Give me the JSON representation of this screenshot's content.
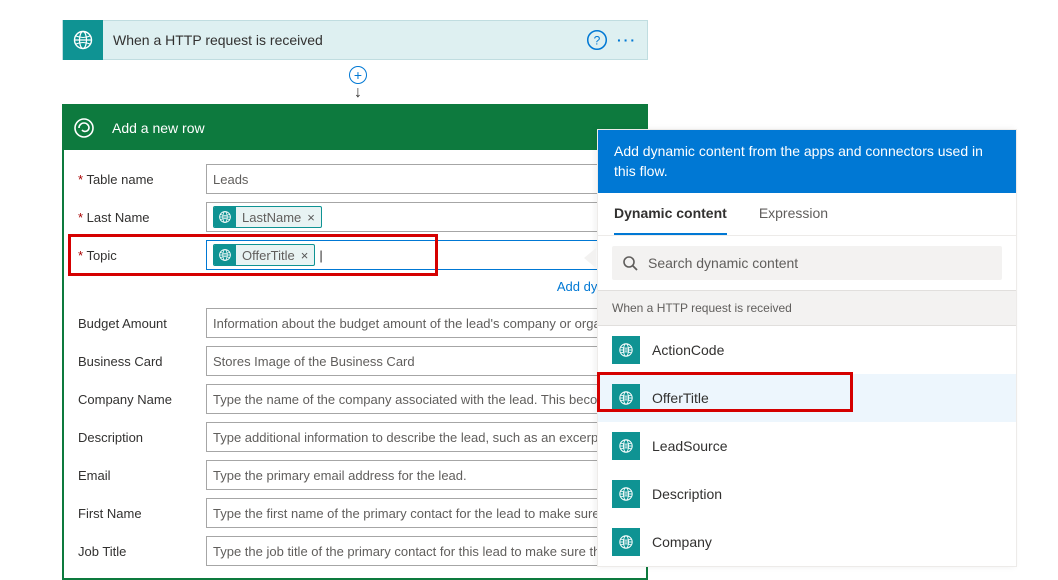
{
  "trigger": {
    "title": "When a HTTP request is received",
    "help_icon": "help-icon",
    "more_icon": "more-icon"
  },
  "connector": {
    "plus": "+",
    "arrow": "↓"
  },
  "action": {
    "title": "Add a new row",
    "fields": {
      "table_name": {
        "label": "Table name",
        "value": "Leads",
        "required": true
      },
      "last_name": {
        "label": "Last Name",
        "token": "LastName",
        "required": true
      },
      "topic": {
        "label": "Topic",
        "token": "OfferTitle",
        "required": true
      },
      "budget_amount": {
        "label": "Budget Amount",
        "placeholder": "Information about the budget amount of the lead's company or organ"
      },
      "business_card": {
        "label": "Business Card",
        "placeholder": "Stores Image of the Business Card"
      },
      "company_name": {
        "label": "Company Name",
        "placeholder": "Type the name of the company associated with the lead. This become"
      },
      "description": {
        "label": "Description",
        "placeholder": "Type additional information to describe the lead, such as an excerpt fr"
      },
      "email": {
        "label": "Email",
        "placeholder": "Type the primary email address for the lead."
      },
      "first_name": {
        "label": "First Name",
        "placeholder": "Type the first name of the primary contact for the lead to make sure th"
      },
      "job_title": {
        "label": "Job Title",
        "placeholder": "Type the job title of the primary contact for this lead to make sure the"
      }
    },
    "add_dynamic_link": "Add dynamic"
  },
  "dyn": {
    "header": "Add dynamic content from the apps and connectors used in this flow.",
    "tab_dynamic": "Dynamic content",
    "tab_expression": "Expression",
    "search_placeholder": "Search dynamic content",
    "section_label": "When a HTTP request is received",
    "items": [
      {
        "label": "ActionCode"
      },
      {
        "label": "OfferTitle",
        "selected": true
      },
      {
        "label": "LeadSource"
      },
      {
        "label": "Description"
      },
      {
        "label": "Company"
      }
    ]
  }
}
